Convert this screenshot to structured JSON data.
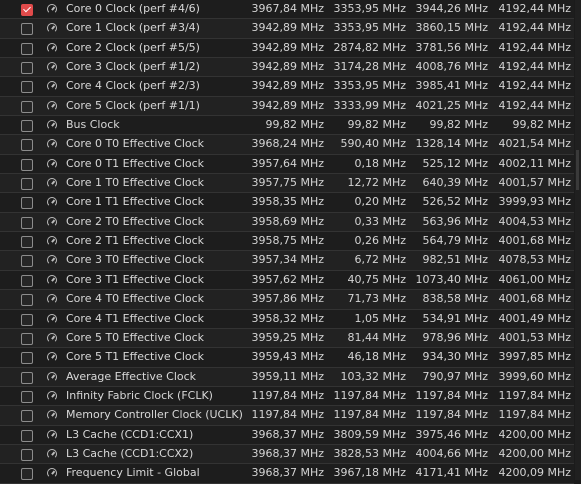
{
  "rows": [
    {
      "name": "Core 0 Clock (perf #4/6)",
      "checked": true,
      "icon": "clock-icon",
      "current": "3967,84 MHz",
      "minimum": "3353,95 MHz",
      "maximum": "3944,26 MHz",
      "average": "4192,44 MHz"
    },
    {
      "name": "Core 1 Clock (perf #3/4)",
      "checked": false,
      "icon": "clock-icon",
      "current": "3942,89 MHz",
      "minimum": "3353,95 MHz",
      "maximum": "3860,15 MHz",
      "average": "4192,44 MHz"
    },
    {
      "name": "Core 2 Clock (perf #5/5)",
      "checked": false,
      "icon": "clock-icon",
      "current": "3942,89 MHz",
      "minimum": "2874,82 MHz",
      "maximum": "3781,56 MHz",
      "average": "4192,44 MHz"
    },
    {
      "name": "Core 3 Clock (perf #1/2)",
      "checked": false,
      "icon": "clock-icon",
      "current": "3942,89 MHz",
      "minimum": "3174,28 MHz",
      "maximum": "4008,76 MHz",
      "average": "4192,44 MHz"
    },
    {
      "name": "Core 4 Clock (perf #2/3)",
      "checked": false,
      "icon": "clock-icon",
      "current": "3942,89 MHz",
      "minimum": "3353,95 MHz",
      "maximum": "3985,41 MHz",
      "average": "4192,44 MHz"
    },
    {
      "name": "Core 5 Clock (perf #1/1)",
      "checked": false,
      "icon": "clock-icon",
      "current": "3942,89 MHz",
      "minimum": "3333,99 MHz",
      "maximum": "4021,25 MHz",
      "average": "4192,44 MHz"
    },
    {
      "name": "Bus Clock",
      "checked": false,
      "icon": "clock-icon",
      "current": "99,82 MHz",
      "minimum": "99,82 MHz",
      "maximum": "99,82 MHz",
      "average": "99,82 MHz"
    },
    {
      "name": "Core 0 T0 Effective Clock",
      "checked": false,
      "icon": "clock-icon",
      "current": "3968,24 MHz",
      "minimum": "590,40 MHz",
      "maximum": "1328,14 MHz",
      "average": "4021,54 MHz"
    },
    {
      "name": "Core 0 T1 Effective Clock",
      "checked": false,
      "icon": "clock-icon",
      "current": "3957,64 MHz",
      "minimum": "0,18 MHz",
      "maximum": "525,12 MHz",
      "average": "4002,11 MHz"
    },
    {
      "name": "Core 1 T0 Effective Clock",
      "checked": false,
      "icon": "clock-icon",
      "current": "3957,75 MHz",
      "minimum": "12,72 MHz",
      "maximum": "640,39 MHz",
      "average": "4001,57 MHz"
    },
    {
      "name": "Core 1 T1 Effective Clock",
      "checked": false,
      "icon": "clock-icon",
      "current": "3958,35 MHz",
      "minimum": "0,20 MHz",
      "maximum": "526,52 MHz",
      "average": "3999,93 MHz"
    },
    {
      "name": "Core 2 T0 Effective Clock",
      "checked": false,
      "icon": "clock-icon",
      "current": "3958,69 MHz",
      "minimum": "0,33 MHz",
      "maximum": "563,96 MHz",
      "average": "4004,53 MHz"
    },
    {
      "name": "Core 2 T1 Effective Clock",
      "checked": false,
      "icon": "clock-icon",
      "current": "3958,75 MHz",
      "minimum": "0,26 MHz",
      "maximum": "564,79 MHz",
      "average": "4001,68 MHz"
    },
    {
      "name": "Core 3 T0 Effective Clock",
      "checked": false,
      "icon": "clock-icon",
      "current": "3957,34 MHz",
      "minimum": "6,72 MHz",
      "maximum": "982,51 MHz",
      "average": "4078,53 MHz"
    },
    {
      "name": "Core 3 T1 Effective Clock",
      "checked": false,
      "icon": "clock-icon",
      "current": "3957,62 MHz",
      "minimum": "40,75 MHz",
      "maximum": "1073,40 MHz",
      "average": "4061,00 MHz"
    },
    {
      "name": "Core 4 T0 Effective Clock",
      "checked": false,
      "icon": "clock-icon",
      "current": "3957,86 MHz",
      "minimum": "71,73 MHz",
      "maximum": "838,58 MHz",
      "average": "4001,68 MHz"
    },
    {
      "name": "Core 4 T1 Effective Clock",
      "checked": false,
      "icon": "clock-icon",
      "current": "3958,32 MHz",
      "minimum": "1,05 MHz",
      "maximum": "534,91 MHz",
      "average": "4001,49 MHz"
    },
    {
      "name": "Core 5 T0 Effective Clock",
      "checked": false,
      "icon": "clock-icon",
      "current": "3959,25 MHz",
      "minimum": "81,44 MHz",
      "maximum": "978,96 MHz",
      "average": "4001,53 MHz"
    },
    {
      "name": "Core 5 T1 Effective Clock",
      "checked": false,
      "icon": "clock-icon",
      "current": "3959,43 MHz",
      "minimum": "46,18 MHz",
      "maximum": "934,30 MHz",
      "average": "3997,85 MHz"
    },
    {
      "name": "Average Effective Clock",
      "checked": false,
      "icon": "clock-icon",
      "current": "3959,11 MHz",
      "minimum": "103,32 MHz",
      "maximum": "790,97 MHz",
      "average": "3999,60 MHz"
    },
    {
      "name": "Infinity Fabric Clock (FCLK)",
      "checked": false,
      "icon": "clock-icon",
      "current": "1197,84 MHz",
      "minimum": "1197,84 MHz",
      "maximum": "1197,84 MHz",
      "average": "1197,84 MHz"
    },
    {
      "name": "Memory Controller Clock (UCLK)",
      "checked": false,
      "icon": "clock-icon",
      "current": "1197,84 MHz",
      "minimum": "1197,84 MHz",
      "maximum": "1197,84 MHz",
      "average": "1197,84 MHz"
    },
    {
      "name": "L3 Cache (CCD1:CCX1)",
      "checked": false,
      "icon": "clock-icon",
      "current": "3968,37 MHz",
      "minimum": "3809,59 MHz",
      "maximum": "3975,46 MHz",
      "average": "4200,00 MHz"
    },
    {
      "name": "L3 Cache (CCD1:CCX2)",
      "checked": false,
      "icon": "clock-icon",
      "current": "3968,37 MHz",
      "minimum": "3828,53 MHz",
      "maximum": "4004,66 MHz",
      "average": "4200,00 MHz"
    },
    {
      "name": "Frequency Limit - Global",
      "checked": false,
      "icon": "clock-icon",
      "current": "3968,37 MHz",
      "minimum": "3967,18 MHz",
      "maximum": "4171,41 MHz",
      "average": "4200,09 MHz"
    }
  ],
  "colors": {
    "checked_accent": "#e14b4b",
    "background": "#1b1b1b",
    "text": "#dcdcdc"
  }
}
